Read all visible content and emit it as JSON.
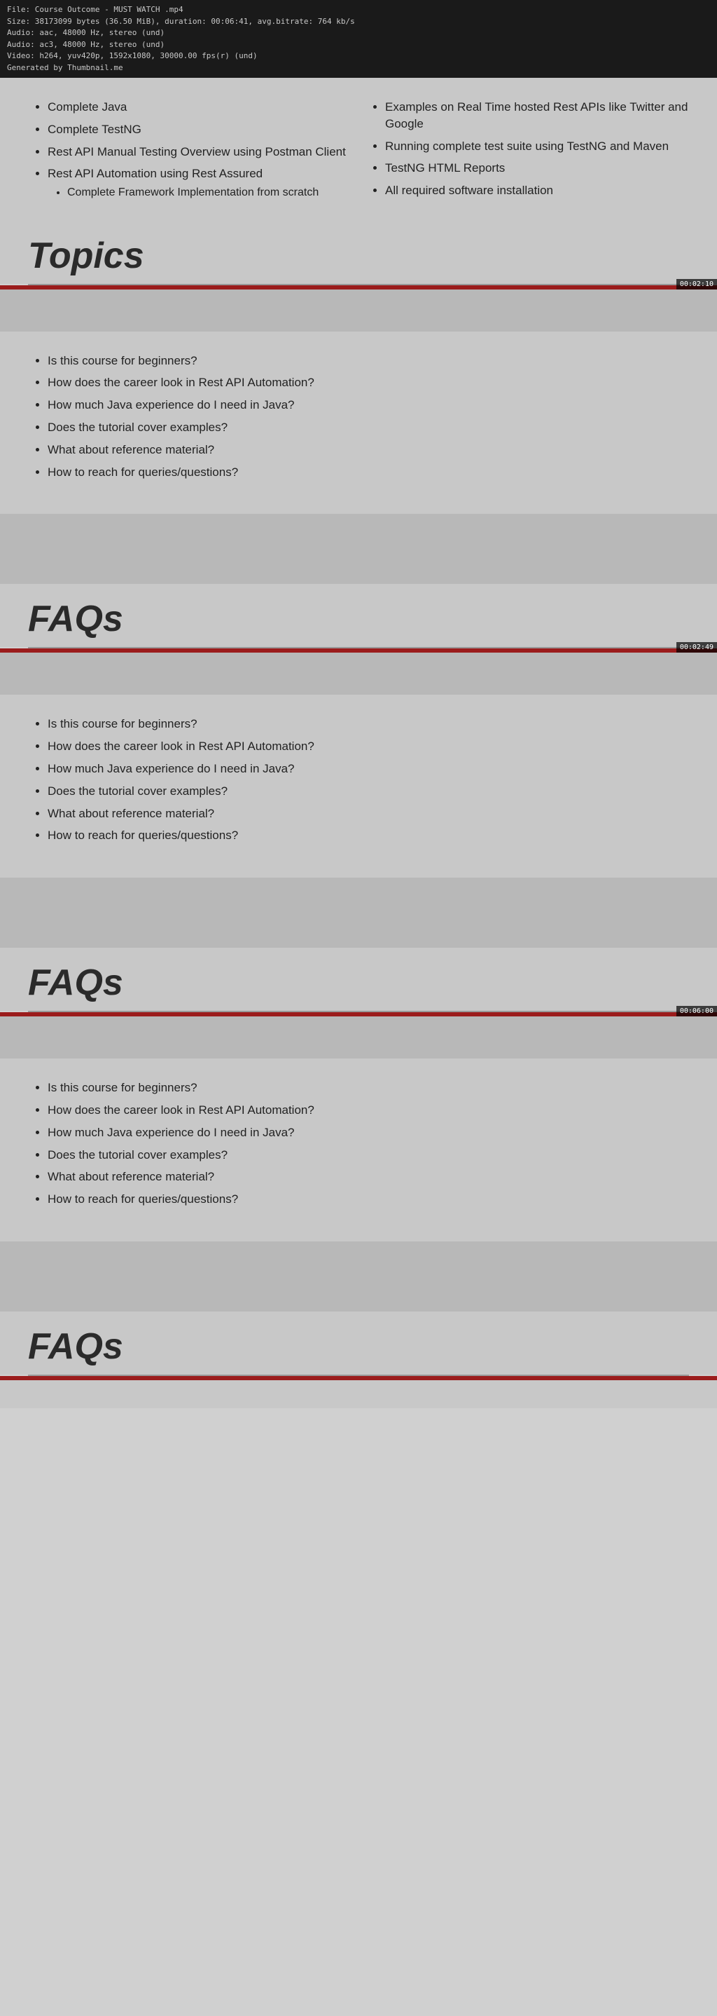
{
  "infoBar": {
    "line1": "File: Course Outcome -  MUST WATCH .mp4",
    "line2": "Size: 38173099 bytes (36.50 MiB), duration: 00:06:41, avg.bitrate: 764 kb/s",
    "line3": "Audio: aac, 48000 Hz, stereo (und)",
    "line4": "Audio: ac3, 48000 Hz, stereo (und)",
    "line5": "Video: h264, yuv420p, 1592x1080, 30000.00 fps(r) (und)",
    "line6": "Generated by Thumbnail.me"
  },
  "leftColumn": {
    "items": [
      "Complete Java",
      "Complete TestNG",
      "Rest API Manual Testing Overview using Postman Client",
      "Rest API Automation using Rest Assured"
    ],
    "nestedItem": {
      "parent": "Rest API Automation using Rest Assured",
      "child": "Complete Framework Implementation from scratch"
    }
  },
  "rightColumn": {
    "items": [
      "Examples on Real Time hosted Rest APIs like Twitter and Google",
      "Running complete test suite using TestNG and Maven",
      "TestNG HTML Reports",
      "All required software installation"
    ]
  },
  "topicsHeading": "Topics",
  "faqsHeading": "FAQs",
  "faqItems": [
    "Is this course for beginners?",
    "How does the career look in Rest API Automation?",
    "How much Java experience do I need in Java?",
    "Does the tutorial cover examples?",
    "What about reference material?",
    "How to reach for queries/questions?"
  ],
  "timestamps": {
    "topics": "00:02:10",
    "faqs1": "00:02:49",
    "faqs2": "00:06:00"
  }
}
